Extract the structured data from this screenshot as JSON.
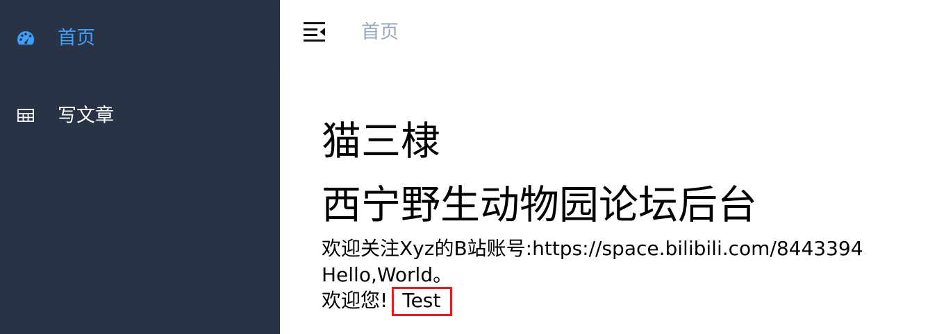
{
  "sidebar": {
    "items": [
      {
        "label": "首页",
        "icon": "dashboard-icon",
        "active": true
      },
      {
        "label": "写文章",
        "icon": "table-icon",
        "active": false
      }
    ],
    "background": "#283446",
    "active_color": "#409eff"
  },
  "header": {
    "collapse_icon": "menu-fold-icon",
    "breadcrumb": "首页"
  },
  "main": {
    "title_line1": "猫三棣",
    "title_line2": "西宁野生动物园论坛后台",
    "follow_text": "欢迎关注Xyz的B站账号:https://space.bilibili.com/8443394",
    "hello_text": "Hello,World。",
    "welcome_prefix": "欢迎您!",
    "welcome_name": "Test",
    "highlight_color": "#e02020"
  }
}
